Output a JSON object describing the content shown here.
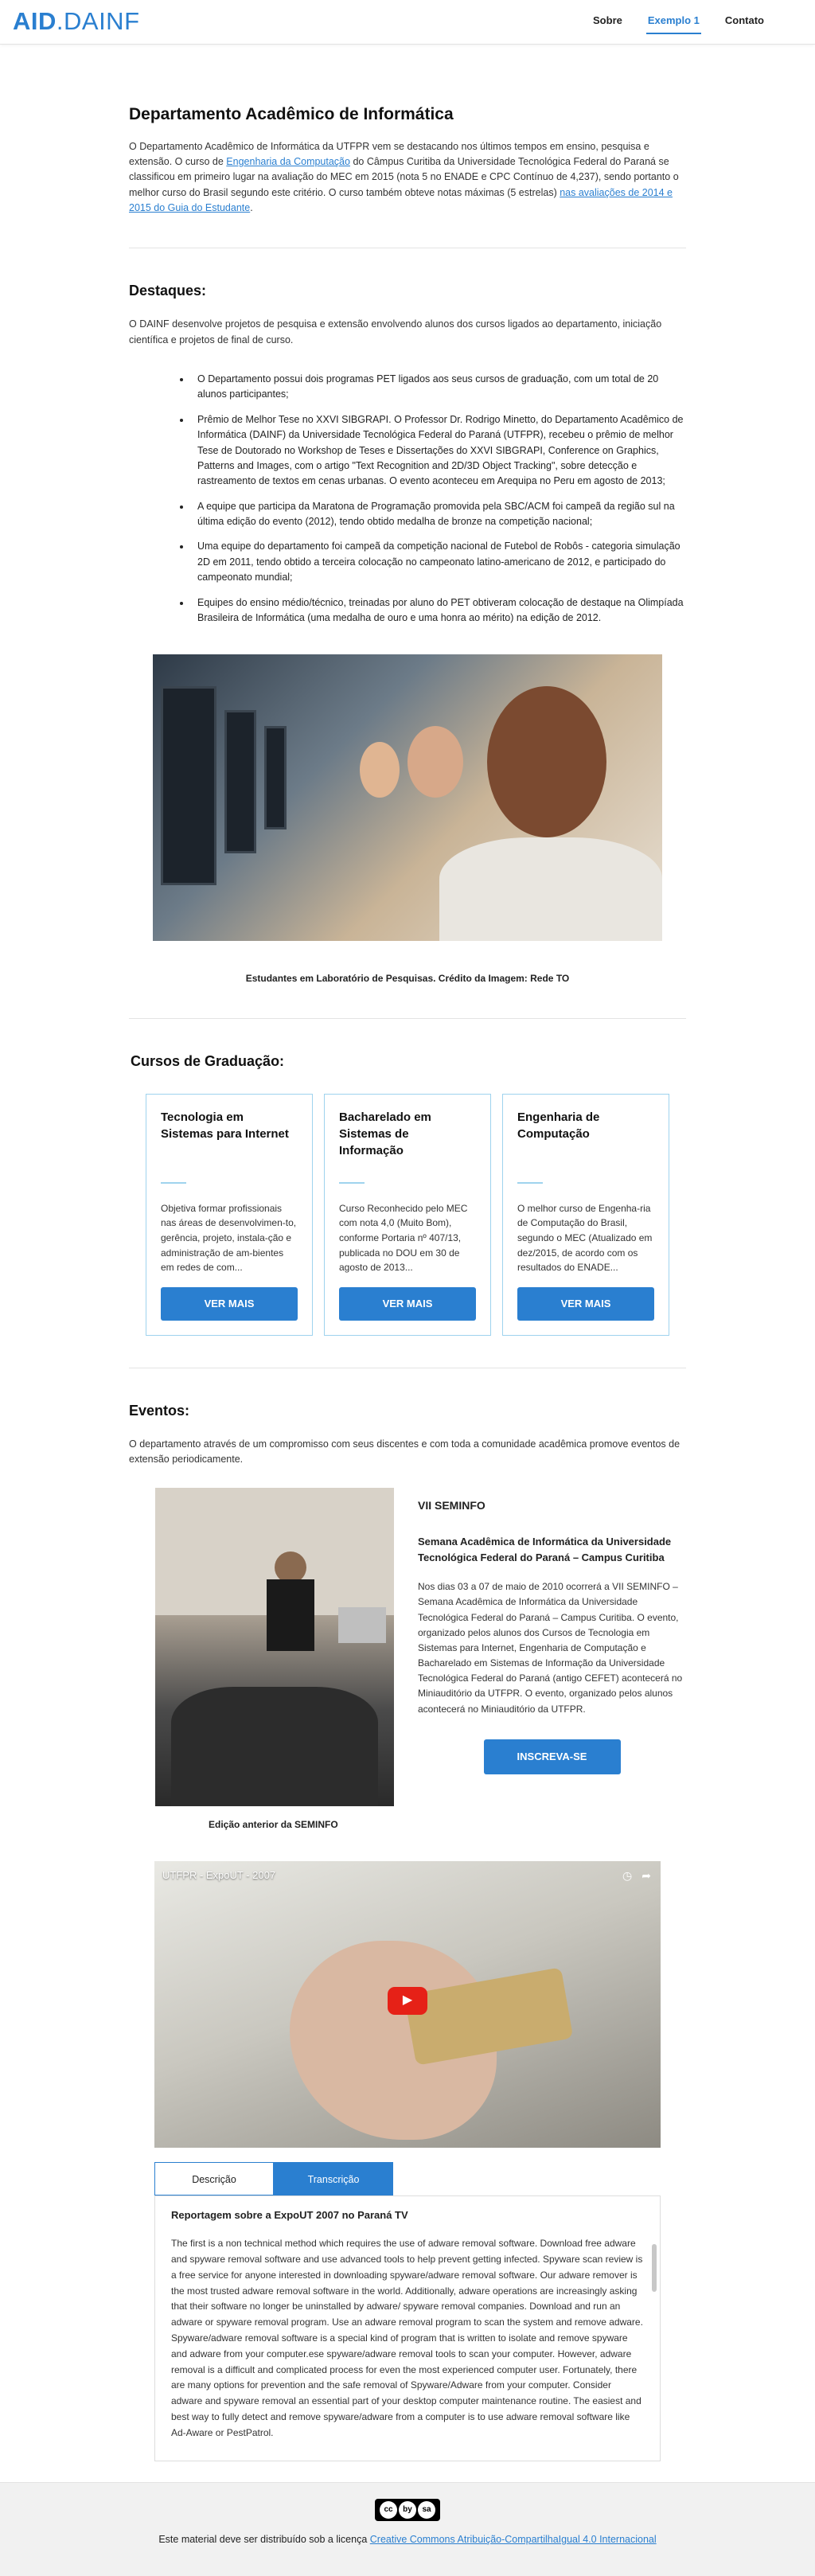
{
  "brand": {
    "logo_bold": "AID",
    "logo_rest": ".DAINF"
  },
  "nav": {
    "items": [
      "Sobre",
      "Exemplo 1",
      "Contato"
    ]
  },
  "intro": {
    "title": "Departamento Acadêmico de Informática",
    "text_1": "O Departamento Acadêmico de Informática da UTFPR  vem se destacando nos últimos tempos  em ensino, pesquisa e extensão. O curso de ",
    "link_1": "Engenharia da Computação",
    "text_2": " do Câmpus Curitiba da Universidade Tecnológica Federal do Paraná se classificou em primeiro lugar na avaliação do MEC em 2015 (nota 5 no ENADE e CPC Contínuo de 4,237), sendo portanto o melhor curso do Brasil segundo este critério. O curso também obteve notas máximas (5 estrelas) ",
    "link_2": "nas avaliações de 2014 e 2015 do Guia do Estudante",
    "text_3": "."
  },
  "highlights": {
    "title": "Destaques:",
    "text": "O DAINF desenvolve projetos de pesquisa e extensão envolvendo alunos dos cursos ligados ao departamento, iniciação científica e projetos de final de curso.",
    "items": [
      "O Departamento possui dois programas PET ligados aos seus cursos de graduação, com um total de 20 alunos participantes;",
      "Prêmio de Melhor Tese no XXVI SIBGRAPI. O Professor Dr. Rodrigo Minetto, do Departamento Acadêmico de Informática (DAINF) da Universidade Tecnológica Federal do Paraná (UTFPR), recebeu o prêmio de melhor Tese de Doutorado no Workshop de Teses e Dissertações do XXVI SIBGRAPI, Conference on Graphics, Patterns and Images, com o artigo \"Text Recognition and 2D/3D Object Tracking\", sobre detecção e rastreamento de textos em cenas urbanas. O evento aconteceu em Arequipa no Peru em agosto de 2013;",
      "A equipe que participa da Maratona de Programação promovida pela SBC/ACM foi campeã da região sul na última edição do evento (2012), tendo obtido medalha de bronze na competição nacional;",
      "Uma equipe do departamento foi campeã  da competição nacional de Futebol de Robôs - categoria simulação 2D em 2011, tendo obtido a terceira colocação no campeonato latino-americano de 2012, e participado do campeonato mundial;",
      "Equipes  do ensino médio/técnico, treinadas por aluno do PET obtiveram colocação de destaque na Olimpíada Brasileira de Informática (uma medalha de ouro e uma honra ao mérito) na edição de 2012."
    ],
    "photo_caption": "Estudantes em Laboratório de Pesquisas. Crédito da Imagem: Rede TO"
  },
  "courses": {
    "title": "Cursos de Graduação:",
    "items": [
      {
        "name": "Tecnologia em Sistemas para Internet",
        "desc": "Objetiva formar profissionais nas áreas de desenvolvimen-to, gerência, projeto, instala-ção e administração de am-bientes em redes de com...",
        "button": "VER MAIS"
      },
      {
        "name": "Bacharelado em Sistemas de Informação",
        "desc": "Curso Reconhecido pelo MEC com nota 4,0 (Muito Bom), conforme Portaria nº 407/13, publicada no DOU em 30 de agosto de 2013...",
        "button": "VER MAIS"
      },
      {
        "name": "Engenharia de Computação",
        "desc": "O melhor curso de Engenha-ria de Computação do Brasil, segundo o MEC (Atualizado em dez/2015, de acordo com os resultados do ENADE...",
        "button": "VER MAIS"
      }
    ]
  },
  "events": {
    "title": "Eventos:",
    "text": "O departamento através de um compromisso com seus discentes e com toda a comunidade acadêmica promove eventos de extensão periodicamente.",
    "event_name": "VII SEMINFO",
    "event_full": "Semana Acadêmica de Informática da Universidade Tecnológica Federal do Paraná – Campus Curitiba",
    "event_desc": "Nos dias 03 a 07 de maio de 2010 ocorrerá a VII SEMINFO – Semana Acadêmica de Informática da Universidade Tecnológica Federal do Paraná – Campus Curitiba. O evento, organizado pelos alunos dos Cursos de Tecnologia em Sistemas para Internet, Engenharia de Computação e Bacharelado em Sistemas de Informação da Universidade Tecnológica Federal do Paraná (antigo CEFET) acontecerá no Miniauditório da UTFPR. O evento, organizado pelos alunos acontecerá no Miniauditório da UTFPR.",
    "button": "INSCREVA-SE",
    "photo_caption": "Edição anterior da SEMINFO"
  },
  "video": {
    "title": "UTFPR - ExpoUT - 2007",
    "tabs": [
      "Descrição",
      "Transcrição"
    ],
    "active_tab": "Transcrição",
    "transcript_title": "Reportagem sobre a ExpoUT 2007 no Paraná TV",
    "transcript_text": "The first is a non technical method which requires the use of adware removal software. Download free adware and spyware removal software and use advanced tools to help prevent getting infected. Spyware scan review is a free service for anyone interested in downloading spyware/adware removal software. Our adware remover is the most trusted adware removal software in the world. Additionally, adware operations are increasingly asking that their software no longer be uninstalled by adware/ spyware removal companies.  Download and run an adware or spyware removal program. Use an adware removal program to scan the system and remove adware. Spyware/adware removal software is a special kind of program that is written to isolate and remove spyware and adware from your computer.ese spyware/adware removal tools to scan your computer. However, adware removal is a difficult and complicated process for even the most experienced computer user. Fortunately, there are many options for prevention and the safe removal of Spyware/Adware from your computer. Consider adware and spyware removal an essential part of your desktop computer maintenance routine. The easiest and best way to fully detect and remove spyware/adware from a computer is to use adware removal software like Ad-Aware or PestPatrol."
  },
  "footer": {
    "badge": "cc by sa",
    "text": "Este material deve ser distribuído sob a licença ",
    "link": "Creative Commons Atribuição-CompartilhaIgual 4.0 Internacional"
  },
  "colors": {
    "accent": "#2a7fd0",
    "card_border": "#9fd3ee"
  }
}
